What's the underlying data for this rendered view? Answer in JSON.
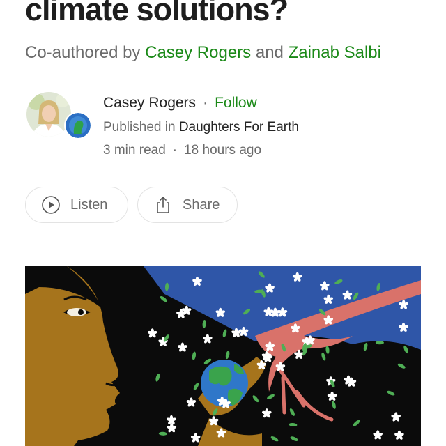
{
  "article": {
    "title": "climate solutions?",
    "coauthor_prefix": "Co-authored by",
    "coauthor_1": "Casey Rogers",
    "coauthor_and": "and",
    "coauthor_2": "Zainab Salbi"
  },
  "author": {
    "name": "Casey Rogers",
    "separator": "·",
    "follow_label": "Follow",
    "published_prefix": "Published in",
    "publication": "Daughters For Earth",
    "read_time": "3 min read",
    "time_separator": "·",
    "posted": "18 hours ago"
  },
  "actions": {
    "listen_label": "Listen",
    "share_label": "Share"
  },
  "icons": {
    "listen": "play-circle-icon",
    "share": "share-icon"
  },
  "colors": {
    "accent_green": "#1a8917",
    "muted_text": "#6b6b6b",
    "hero_sky": "#2f56a8",
    "hero_skin": "#a6741c",
    "hero_branch": "#e07a6a"
  }
}
